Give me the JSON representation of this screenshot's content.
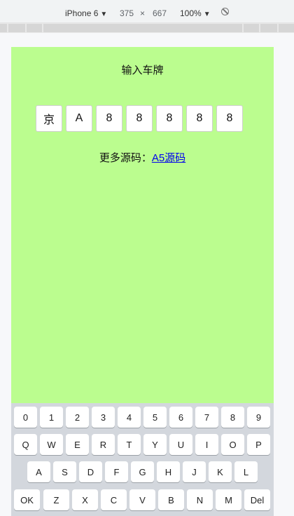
{
  "devtools": {
    "device": "iPhone 6",
    "width": "375",
    "times": "×",
    "height": "667",
    "zoom": "100%"
  },
  "page": {
    "title": "输入车牌",
    "plate": [
      "京",
      "A",
      "8",
      "8",
      "8",
      "8",
      "8"
    ],
    "more_label": "更多源码：",
    "more_link": "A5源码"
  },
  "keyboard": {
    "row1": [
      "0",
      "1",
      "2",
      "3",
      "4",
      "5",
      "6",
      "7",
      "8",
      "9"
    ],
    "row2": [
      "Q",
      "W",
      "E",
      "R",
      "T",
      "Y",
      "U",
      "I",
      "O",
      "P"
    ],
    "row3": [
      "A",
      "S",
      "D",
      "F",
      "G",
      "H",
      "J",
      "K",
      "L"
    ],
    "row4": [
      "OK",
      "Z",
      "X",
      "C",
      "V",
      "B",
      "N",
      "M",
      "Del"
    ]
  }
}
